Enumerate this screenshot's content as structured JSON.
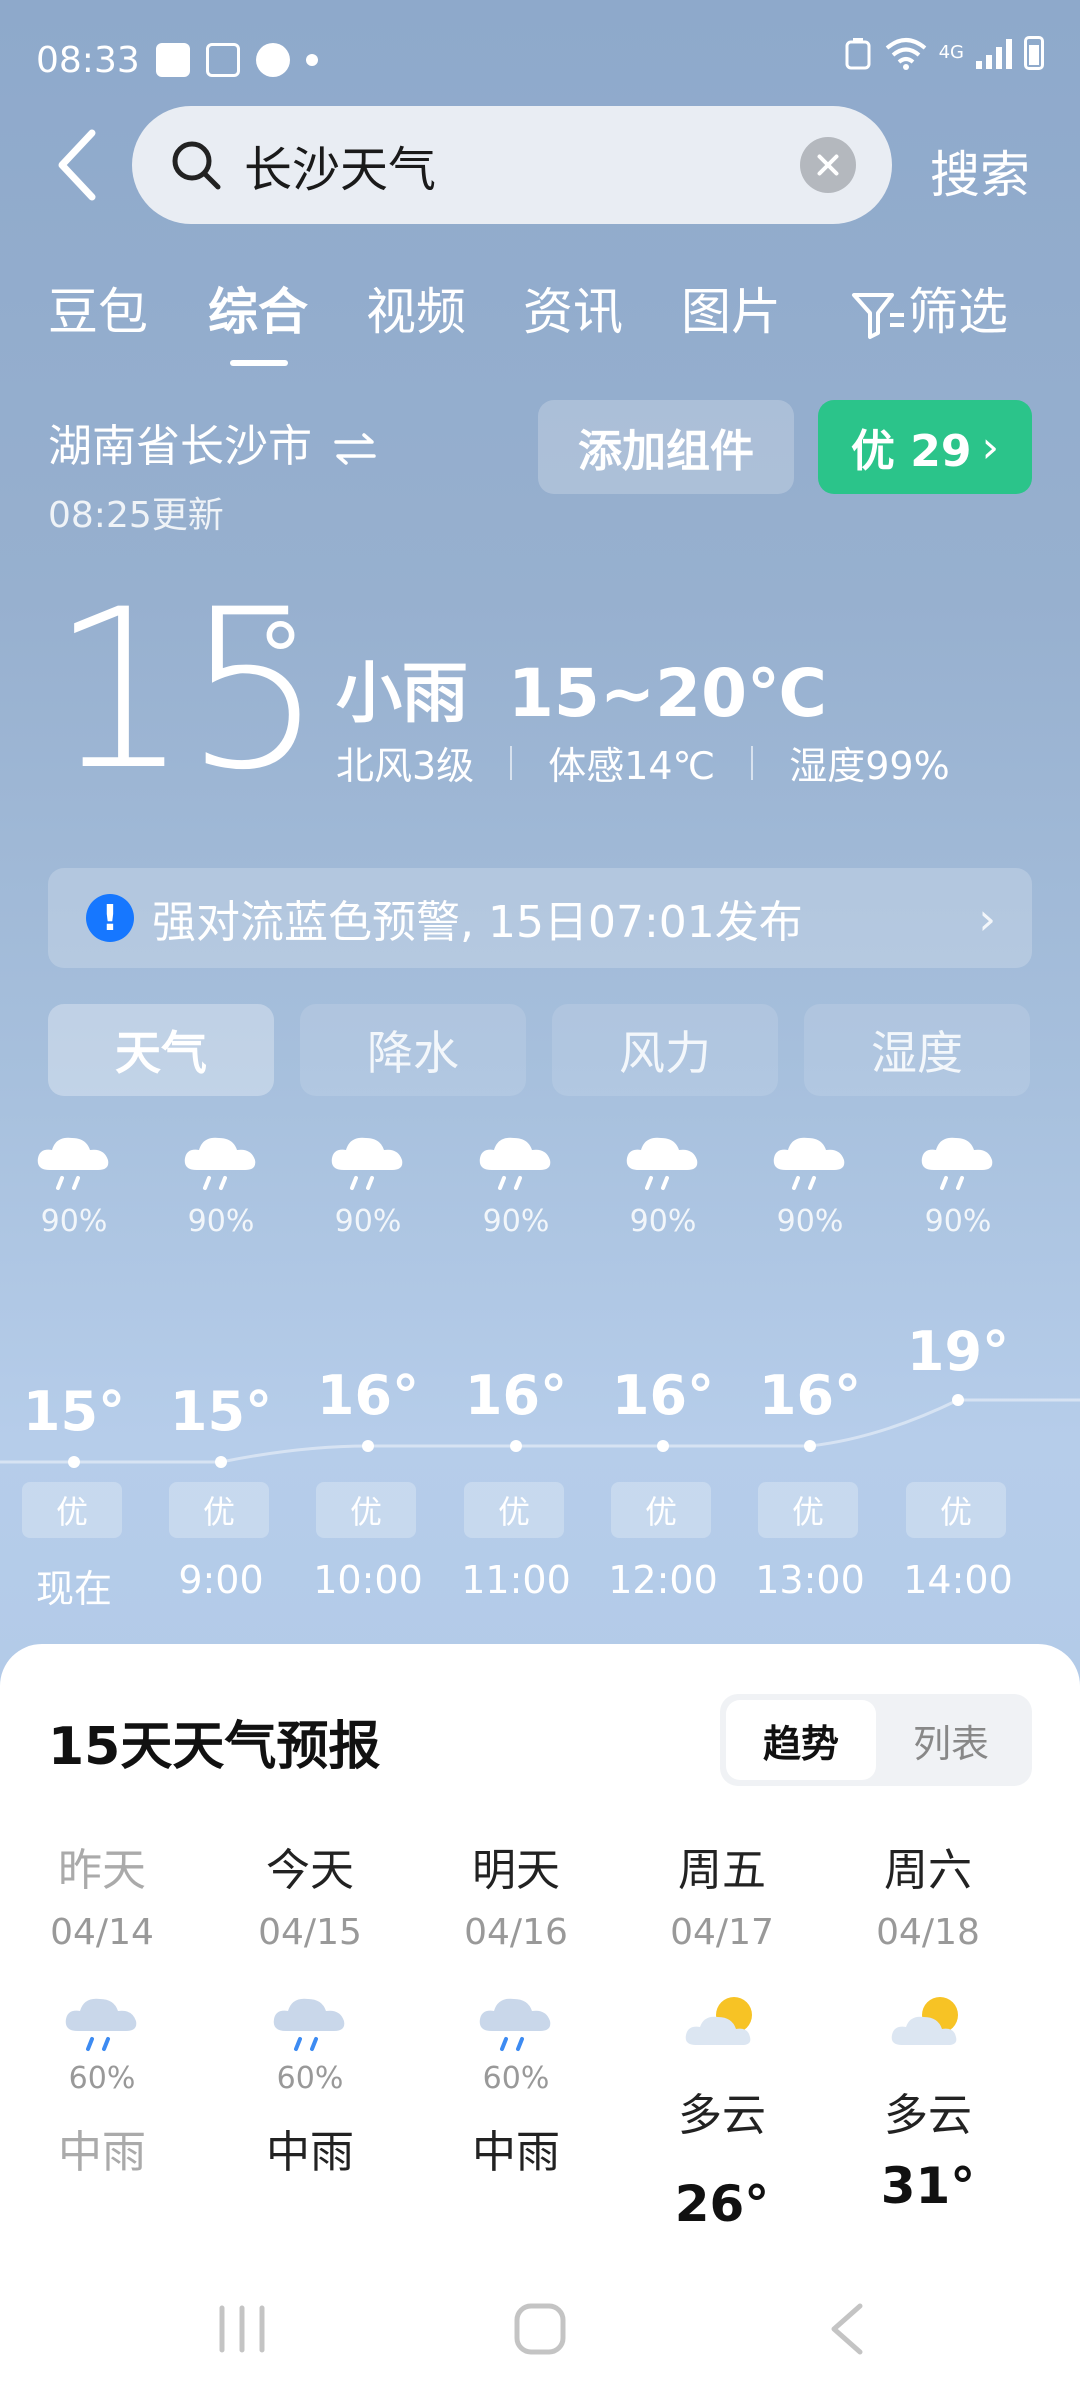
{
  "status_bar": {
    "time": "08:33",
    "network": "4G"
  },
  "search": {
    "query": "长沙天气",
    "button_label": "搜索"
  },
  "tabs": [
    {
      "label": "豆包",
      "active": false
    },
    {
      "label": "综合",
      "active": true
    },
    {
      "label": "视频",
      "active": false
    },
    {
      "label": "资讯",
      "active": false
    },
    {
      "label": "图片",
      "active": false
    },
    {
      "label": "筛选",
      "active": false
    }
  ],
  "location": {
    "name": "湖南省长沙市",
    "updated": "08:25更新"
  },
  "add_widget_label": "添加组件",
  "aqi_badge": "优 29",
  "current": {
    "temp": "15",
    "condition": "小雨",
    "range": "15~20℃",
    "wind": "北风3级",
    "feels_like": "体感14℃",
    "humidity": "湿度99%"
  },
  "warning": {
    "text": "强对流蓝色预警, 15日07:01发布"
  },
  "segments": [
    {
      "label": "天气",
      "active": true
    },
    {
      "label": "降水",
      "active": false
    },
    {
      "label": "风力",
      "active": false
    },
    {
      "label": "湿度",
      "active": false
    }
  ],
  "hourly": [
    {
      "time": "现在",
      "temp": "15°",
      "prob": "90%",
      "aqi": "优"
    },
    {
      "time": "9:00",
      "temp": "15°",
      "prob": "90%",
      "aqi": "优"
    },
    {
      "time": "10:00",
      "temp": "16°",
      "prob": "90%",
      "aqi": "优"
    },
    {
      "time": "11:00",
      "temp": "16°",
      "prob": "90%",
      "aqi": "优"
    },
    {
      "time": "12:00",
      "temp": "16°",
      "prob": "90%",
      "aqi": "优"
    },
    {
      "time": "13:00",
      "temp": "16°",
      "prob": "90%",
      "aqi": "优"
    },
    {
      "time": "14:00",
      "temp": "19°",
      "prob": "90%",
      "aqi": "优"
    }
  ],
  "forecast": {
    "title": "15天天气预报",
    "toggle": [
      "趋势",
      "列表"
    ],
    "days": [
      {
        "name": "昨天",
        "date": "04/14",
        "prob": "60%",
        "cond": "中雨",
        "icon": "rain-cloud-icon",
        "temp": ""
      },
      {
        "name": "今天",
        "date": "04/15",
        "prob": "60%",
        "cond": "中雨",
        "icon": "rain-cloud-icon",
        "temp": ""
      },
      {
        "name": "明天",
        "date": "04/16",
        "prob": "60%",
        "cond": "中雨",
        "icon": "rain-cloud-icon",
        "temp": ""
      },
      {
        "name": "周五",
        "date": "04/17",
        "prob": "",
        "cond": "多云",
        "icon": "partly-cloudy-icon",
        "temp": "26°"
      },
      {
        "name": "周六",
        "date": "04/18",
        "prob": "",
        "cond": "多云",
        "icon": "partly-cloudy-icon",
        "temp": "31°"
      }
    ]
  },
  "colors": {
    "aqi_green": "#2bc48a",
    "warning_blue": "#1677ff",
    "sun_yellow": "#f7c325"
  }
}
